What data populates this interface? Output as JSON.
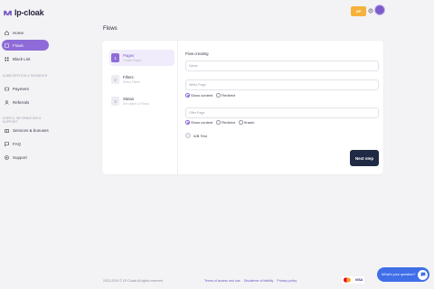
{
  "app": {
    "name": "lp-cloak"
  },
  "sidebar": {
    "items": [
      {
        "label": "Home",
        "icon": "home-icon"
      },
      {
        "label": "Flows",
        "icon": "flows-icon",
        "active": true
      },
      {
        "label": "Black List",
        "icon": "list-icon"
      }
    ],
    "section_subscription": "SUBSCRIPTION & PAYMENTS",
    "subscription_items": [
      {
        "label": "Payment",
        "icon": "card-icon"
      },
      {
        "label": "Referrals",
        "icon": "users-icon"
      }
    ],
    "section_info": "USEFUL INFORMATION & SUPPORT",
    "info_items": [
      {
        "label": "Services & bonuses",
        "icon": "gift-icon"
      },
      {
        "label": "FAQ",
        "icon": "chat-icon"
      },
      {
        "label": "Support",
        "icon": "support-icon"
      }
    ]
  },
  "header": {
    "upgrade_label": "UP",
    "accent": "#f5b23a"
  },
  "page": {
    "title": "Flows"
  },
  "steps": [
    {
      "num": "1",
      "title": "Pages",
      "sub": "Create Pages",
      "active": true
    },
    {
      "num": "2",
      "title": "Filters",
      "sub": "Setup Filters",
      "active": false
    },
    {
      "num": "3",
      "title": "Status",
      "sub": "Set status of Flows",
      "active": false
    }
  ],
  "form": {
    "heading": "Flow creating",
    "name_placeholder": "Name",
    "white_placeholder": "White Page",
    "white_options": [
      "Show content",
      "Redirect"
    ],
    "offer_placeholder": "Offer Page",
    "offer_options": [
      "Show content",
      "Redirect",
      "Iframe"
    ],
    "ab_label": "A/B Test",
    "next_label": "Next step"
  },
  "footer": {
    "copyright": "2023-2024 © LP-Cloak All rights reserved",
    "links": [
      "Terms of access and use",
      "Disclaimer of liability",
      "Privacy policy"
    ],
    "visa": "VISA",
    "help": "What's your question?"
  },
  "colors": {
    "primary": "#8e6bd8",
    "dark_button": "#1f2a44",
    "help": "#3f6ee8"
  }
}
